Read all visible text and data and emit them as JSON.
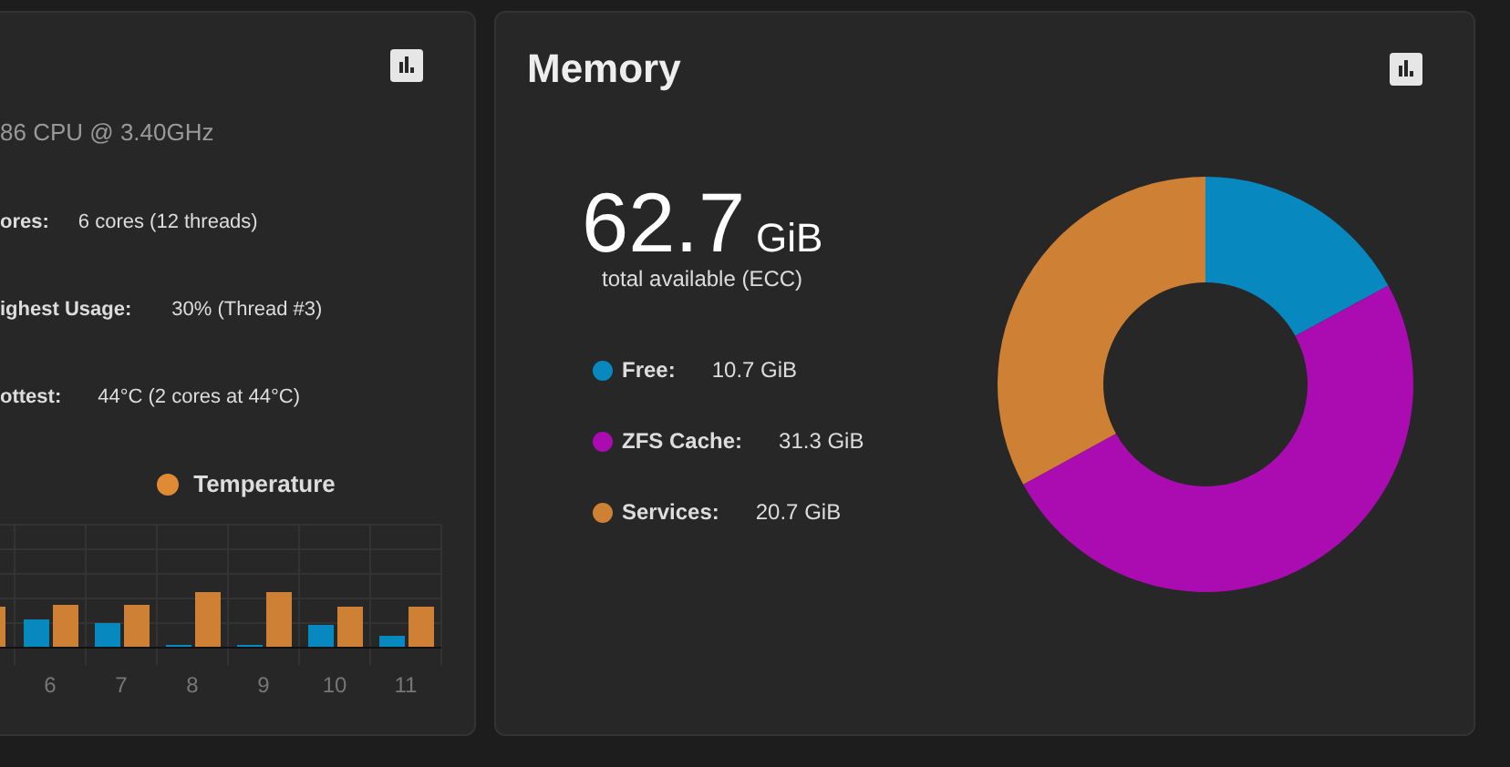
{
  "cpu_panel": {
    "model": "86 CPU @ 3.40GHz",
    "stats": [
      {
        "label": "ores:",
        "value": "6 cores  (12 threads)"
      },
      {
        "label": "ighest Usage:",
        "value": "30%  (Thread #3)"
      },
      {
        "label": "ottest:",
        "value": "44°C  (2 cores at 44°C)"
      }
    ],
    "legend": [
      {
        "label": "Temperature",
        "color": "#e08a35"
      }
    ],
    "x_labels": [
      "6",
      "7",
      "8",
      "9",
      "10",
      "11"
    ]
  },
  "memory_panel": {
    "title": "Memory",
    "total": "62.7",
    "unit": "GiB",
    "caption": "total available (ECC)",
    "legend": [
      {
        "label": "Free:",
        "value": "10.7 GiB",
        "color": "#0788bf"
      },
      {
        "label": "ZFS Cache:",
        "value": "31.3 GiB",
        "color": "#aa0cb1"
      },
      {
        "label": "Services:",
        "value": "20.7 GiB",
        "color": "#ce8035"
      }
    ],
    "chart_data": {
      "type": "donut",
      "values": [
        17.1,
        49.9,
        33.0
      ]
    }
  }
}
